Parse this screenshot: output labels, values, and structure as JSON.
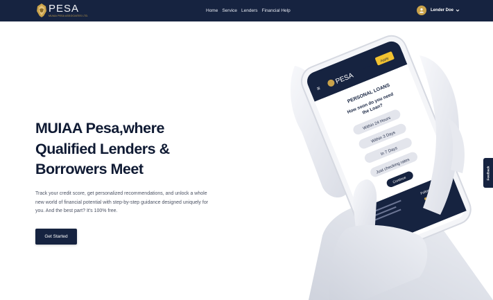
{
  "header": {
    "logo_text": "PESA",
    "logo_subtext": "MUIAA PESA ASSOCIATES LTD.",
    "nav_items": [
      {
        "label": "Home"
      },
      {
        "label": "Service"
      },
      {
        "label": "Lenders"
      },
      {
        "label": "Financial Help"
      }
    ],
    "user_name": "Lender Doe"
  },
  "hero": {
    "title_lines": [
      "MUIAA Pesa,where",
      "Qualified Lenders &",
      "Borrowers Meet"
    ],
    "description": "Track your credit score, get personalized recommendations, and unlock a whole new world of financial potential with step-by-step guidance designed uniquely for you. And the best part? It's 100% free.",
    "cta_label": "Get Started"
  },
  "phone_screen": {
    "logo_text": "PESA",
    "apply_button": "Apply",
    "heading": "PERSONAL LOANS",
    "question_line1": "How soon do you need",
    "question_line2": "the Loan?",
    "options": [
      "Within 24 Hours",
      "Within 3 Days",
      "In 7 Days",
      "Just checking rates"
    ],
    "continue_label": "Continue",
    "follow_label": "Follow Us"
  },
  "feedback_label": "Feedback",
  "colors": {
    "navy": "#162340",
    "gold": "#c9a24a",
    "title_text": "#0f1a33",
    "body_text": "#4b5263"
  }
}
